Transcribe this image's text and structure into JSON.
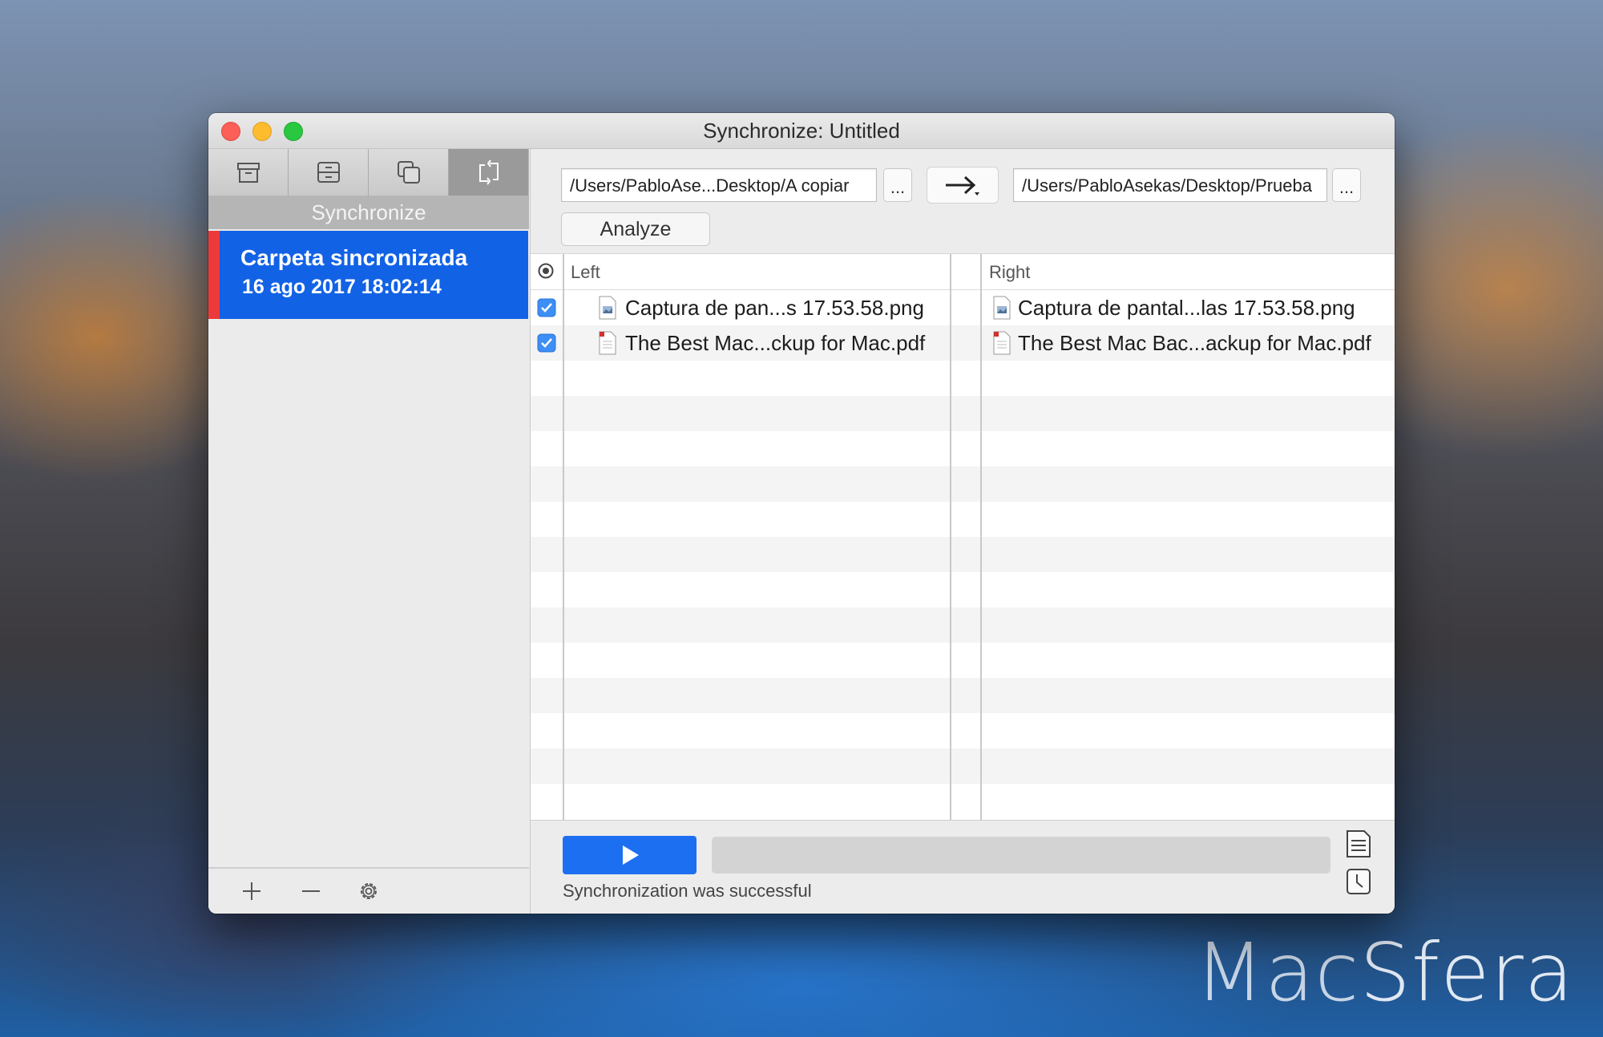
{
  "window": {
    "title": "Synchronize: Untitled"
  },
  "sidebar": {
    "modes": [
      {
        "icon": "archive-box-icon"
      },
      {
        "icon": "drawer-icon"
      },
      {
        "icon": "copy-squares-icon"
      },
      {
        "icon": "sync-arrows-icon",
        "active": true
      }
    ],
    "mode_label": "Synchronize",
    "jobs": [
      {
        "name": "Carpeta sincronizada",
        "date": "16 ago 2017 18:02:14",
        "marker_color": "#ec3a3a"
      }
    ],
    "footer": {
      "add_label": "+",
      "remove_label": "—",
      "settings_icon": "gear-icon"
    }
  },
  "paths": {
    "left": "/Users/PabloAse...Desktop/A copiar",
    "right": "/Users/PabloAsekas/Desktop/Prueba",
    "browse_label": "...",
    "direction_icon": "right-arrow-icon"
  },
  "analyze_label": "Analyze",
  "table": {
    "header_left": "Left",
    "header_right": "Right",
    "rows": [
      {
        "checked": true,
        "type": "png",
        "left": "Captura de pan...s 17.53.58.png",
        "right": "Captura de pantal...las 17.53.58.png"
      },
      {
        "checked": true,
        "type": "pdf",
        "left": "The Best Mac...ckup for Mac.pdf",
        "right": "The Best Mac Bac...ackup for Mac.pdf"
      }
    ]
  },
  "status": {
    "message": "Synchronization was successful",
    "progress": 0,
    "accent": "#1d6ff2"
  },
  "watermark": {
    "text_a": "Mac",
    "text_b": "Sfera"
  }
}
